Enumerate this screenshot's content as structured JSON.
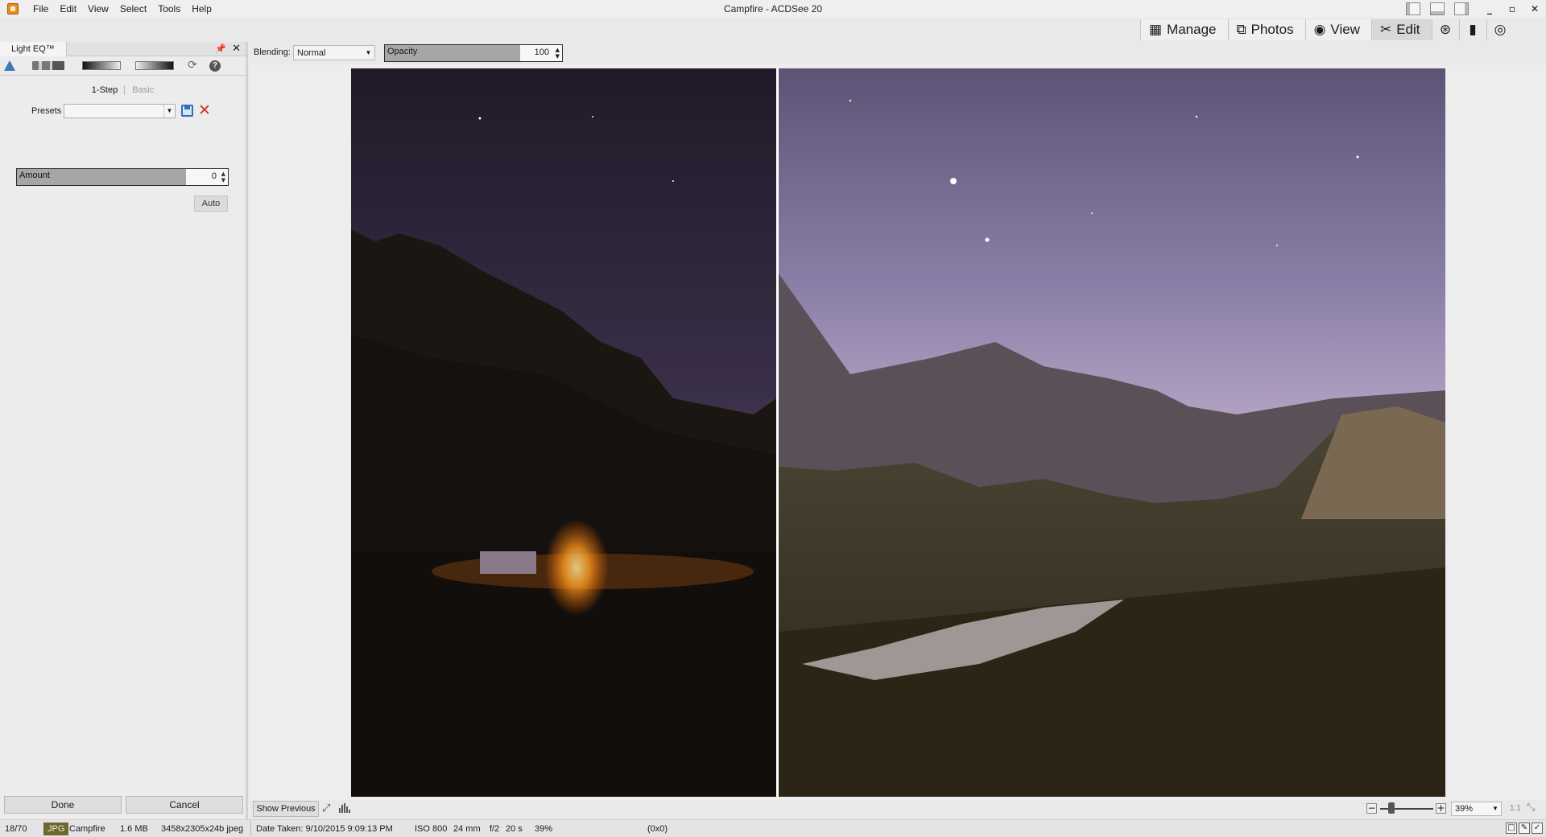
{
  "window": {
    "title": "Campfire - ACDSee 20",
    "controls": [
      "_",
      "▫",
      "✕"
    ]
  },
  "menu": [
    "File",
    "Edit",
    "View",
    "Select",
    "Tools",
    "Help"
  ],
  "modes": {
    "tabs": [
      {
        "label": "Manage",
        "icon": "grid-icon",
        "active": false
      },
      {
        "label": "Photos",
        "icon": "photos-icon",
        "active": false
      },
      {
        "label": "View",
        "icon": "eye-icon",
        "active": false
      },
      {
        "label": "Edit",
        "icon": "edit-tools-icon",
        "active": true
      }
    ],
    "extra_icons": [
      "365-icon",
      "dashboard-icon",
      "develop-eye-icon"
    ]
  },
  "panel": {
    "tab_title": "Light EQ™",
    "pin_glyph": "📌",
    "close_glyph": "✕",
    "modes": {
      "active": "1-Step",
      "inactive": "Basic"
    },
    "presets_label": "Presets",
    "presets_value": "",
    "amount": {
      "label": "Amount",
      "value": "0"
    },
    "auto_label": "Auto",
    "done_label": "Done",
    "cancel_label": "Cancel"
  },
  "edit_toolbar": {
    "blending_label": "Blending:",
    "blending_value": "Normal",
    "opacity_label": "Opacity",
    "opacity_value": "100"
  },
  "canvas": {
    "show_previous_label": "Show Previous",
    "zoom_value": "39%",
    "one_to_one_label": "1:1"
  },
  "status": {
    "index": "18/70",
    "format": "JPG",
    "filename": "Campfire",
    "size": "1.6 MB",
    "dimensions": "3458x2305x24b jpeg",
    "date_taken": "Date Taken: 9/10/2015 9:09:13 PM",
    "iso": "ISO 800",
    "focal": "24 mm",
    "aperture": "f/2",
    "shutter": "20 s",
    "zoom": "39%",
    "coords": "(0x0)"
  }
}
